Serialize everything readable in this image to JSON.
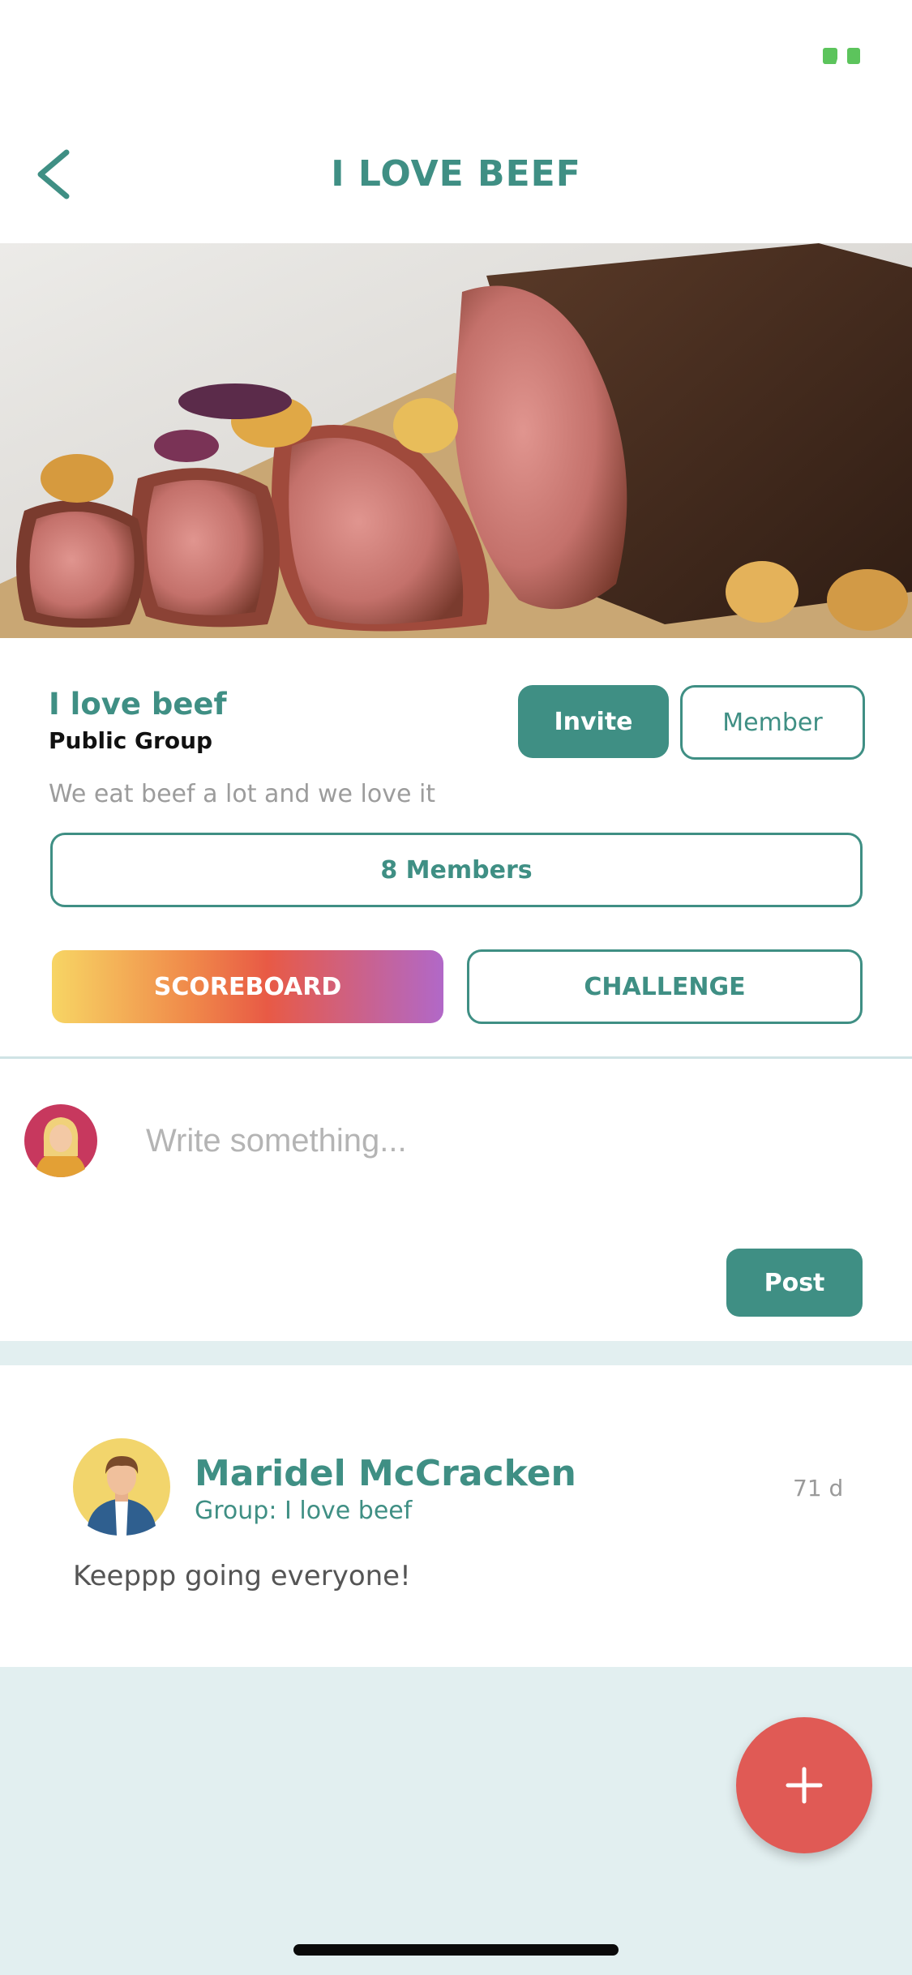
{
  "header": {
    "title": "I LOVE BEEF"
  },
  "group": {
    "name": "I love beef",
    "type": "Public Group",
    "description": "We eat beef a lot and we love it",
    "invite_label": "Invite",
    "member_label": "Member",
    "members_label": "8 Members",
    "scoreboard_label": "SCOREBOARD",
    "challenge_label": "CHALLENGE"
  },
  "composer": {
    "placeholder": "Write something...",
    "post_label": "Post"
  },
  "feed": {
    "posts": [
      {
        "author": "Maridel McCracken",
        "group": "Group: I love beef",
        "time": "71 d",
        "text": "Keeppp going everyone!"
      }
    ]
  },
  "icons": {
    "back": "chevron-left-icon",
    "fab": "plus-icon",
    "battery": "battery-icon"
  },
  "colors": {
    "accent": "#3f8f84",
    "fab": "#e05a55",
    "background": "#e2eff0"
  }
}
